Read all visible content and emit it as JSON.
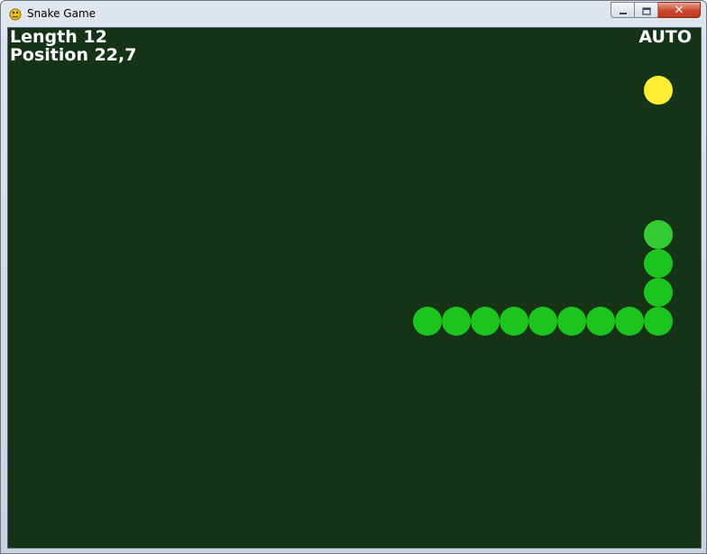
{
  "window": {
    "title": "Snake Game",
    "icon": "pygame-snake-icon",
    "controls": [
      "minimize-icon",
      "maximize-icon",
      "close-icon"
    ],
    "close_glyph": "✕"
  },
  "hud": {
    "length_text": "Length 12",
    "position_text": "Position 22,7",
    "mode_text": "AUTO"
  },
  "game": {
    "colors": {
      "background": "#153316",
      "snake_head": "#33cc33",
      "snake_body": "#1ec41e",
      "food": "#ffee33"
    },
    "food": {
      "col": 22,
      "row": 2
    },
    "snake": [
      {
        "col": 22,
        "row": 7,
        "head": true
      },
      {
        "col": 22,
        "row": 8
      },
      {
        "col": 22,
        "row": 9
      },
      {
        "col": 22,
        "row": 10
      },
      {
        "col": 21,
        "row": 10
      },
      {
        "col": 20,
        "row": 10
      },
      {
        "col": 19,
        "row": 10
      },
      {
        "col": 18,
        "row": 10
      },
      {
        "col": 17,
        "row": 10
      },
      {
        "col": 16,
        "row": 10
      },
      {
        "col": 15,
        "row": 10
      },
      {
        "col": 14,
        "row": 10
      }
    ]
  }
}
